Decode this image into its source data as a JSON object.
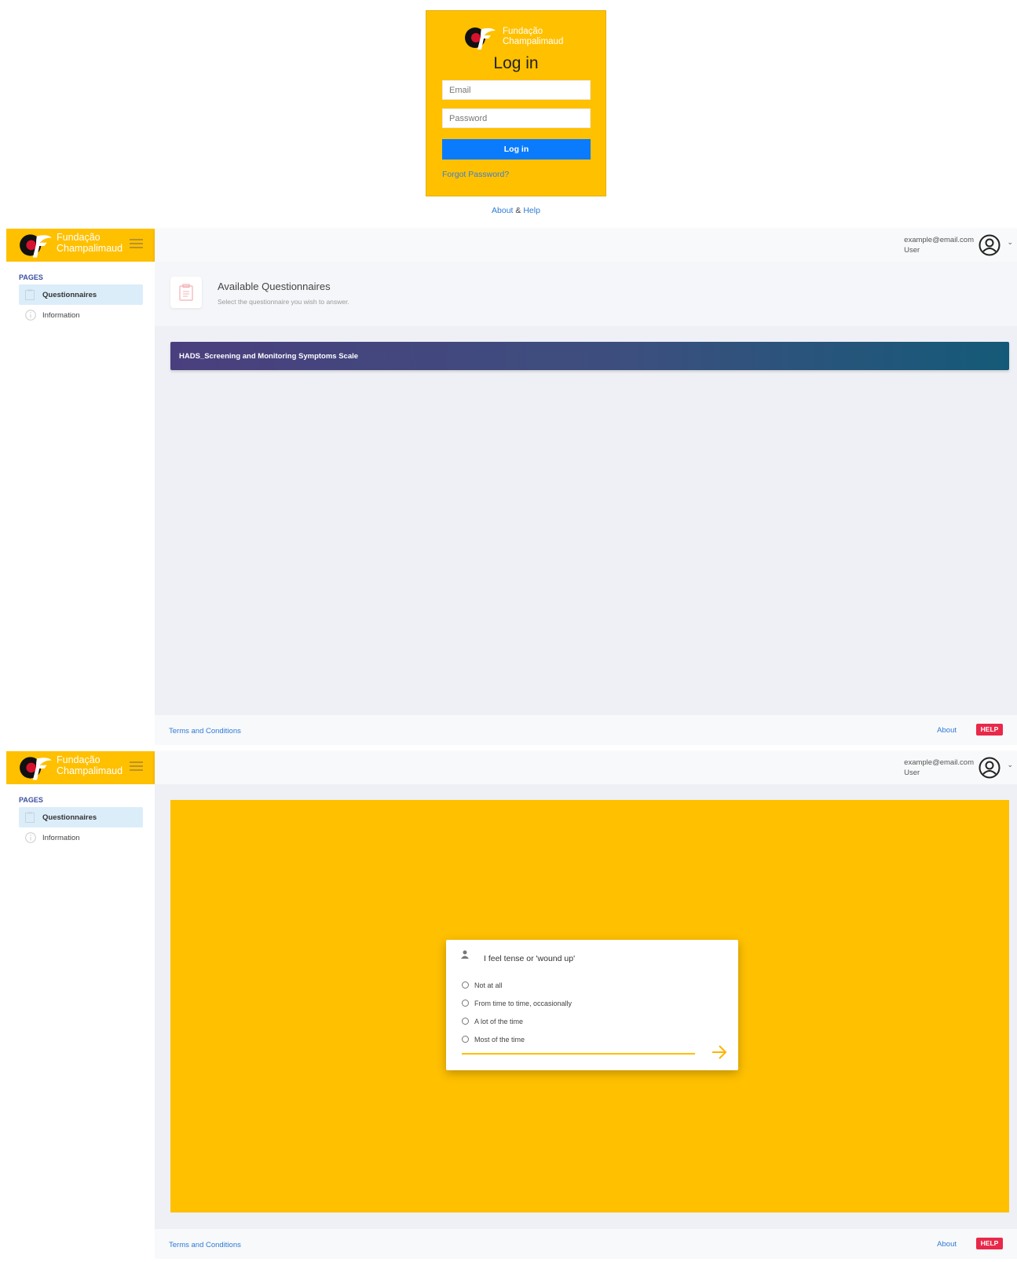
{
  "brand": {
    "line1": "Fundação",
    "line2": "Champalimaud"
  },
  "login": {
    "title": "Log in",
    "email_placeholder": "Email",
    "password_placeholder": "Password",
    "button": "Log in",
    "forgot": "Forgot Password?",
    "about": "About",
    "amp": "&",
    "help": "Help"
  },
  "user": {
    "email": "example@email.com",
    "role": "User"
  },
  "sidebar": {
    "section": "PAGES",
    "items": [
      {
        "label": "Questionnaires",
        "icon": "clipboard-icon",
        "active": true
      },
      {
        "label": "Information",
        "icon": "info-icon",
        "active": false
      }
    ]
  },
  "questionnaires_page": {
    "title": "Available Questionnaires",
    "subtitle": "Select the questionnaire you wish to answer.",
    "items": [
      "HADS_Screening and Monitoring Symptoms Scale"
    ]
  },
  "question": {
    "text": "I feel tense or 'wound up'",
    "options": [
      "Not at all",
      "From time to time, occasionally",
      "A lot of the time",
      "Most of the time"
    ]
  },
  "footer": {
    "terms": "Terms and Conditions",
    "about": "About",
    "help": "HELP"
  },
  "colors": {
    "brand_yellow": "#ffc000",
    "primary_blue": "#0b7bfd",
    "help_red": "#e8294a",
    "active_nav": "#dcedfa"
  }
}
